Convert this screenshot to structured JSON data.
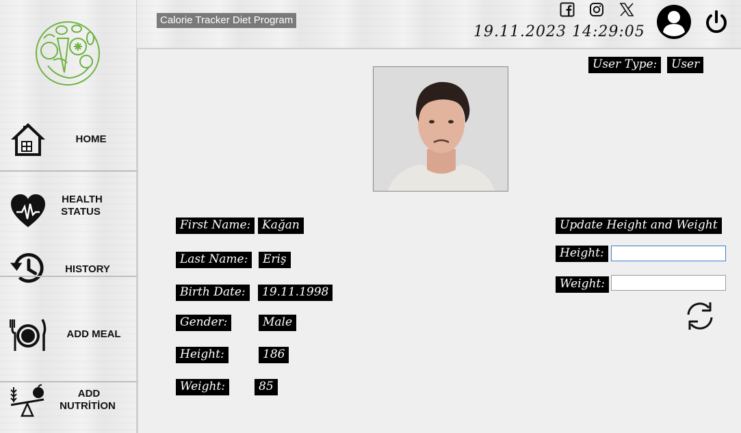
{
  "app": {
    "title": "Calorie Tracker Diet Program"
  },
  "header": {
    "datetime": "19.11.2023 14:29:05",
    "social": [
      "facebook-icon",
      "instagram-icon",
      "x-icon"
    ]
  },
  "sidebar": {
    "items": [
      {
        "label": "HOME",
        "icon": "home-icon"
      },
      {
        "label_line1": "HEALTH",
        "label_line2": "STATUS",
        "icon": "heart-pulse-icon"
      },
      {
        "label": "HISTORY",
        "icon": "history-icon"
      },
      {
        "label": "ADD MEAL",
        "icon": "plate-utensils-icon"
      },
      {
        "label_line1": "ADD",
        "label_line2": "NUTRİTİON",
        "icon": "scale-apple-wheat-icon"
      }
    ]
  },
  "profile": {
    "user_type_label": "User Type:",
    "user_type_value": "User",
    "fields": [
      {
        "label": "First Name:",
        "value": "Kağan"
      },
      {
        "label": "Last Name:",
        "value": "Eriş"
      },
      {
        "label": "Birth Date:",
        "value": "19.11.1998"
      },
      {
        "label": "Gender:",
        "value": "Male"
      },
      {
        "label": "Height:",
        "value": "186"
      },
      {
        "label": "Weight:",
        "value": "85"
      }
    ]
  },
  "update": {
    "title": "Update Height and Weight",
    "height_label": "Height:",
    "weight_label": "Weight:",
    "height_value": "",
    "weight_value": ""
  },
  "colors": {
    "accent_green": "#6db33f",
    "tag_bg": "#000000",
    "title_bg": "#7a7a7a"
  }
}
